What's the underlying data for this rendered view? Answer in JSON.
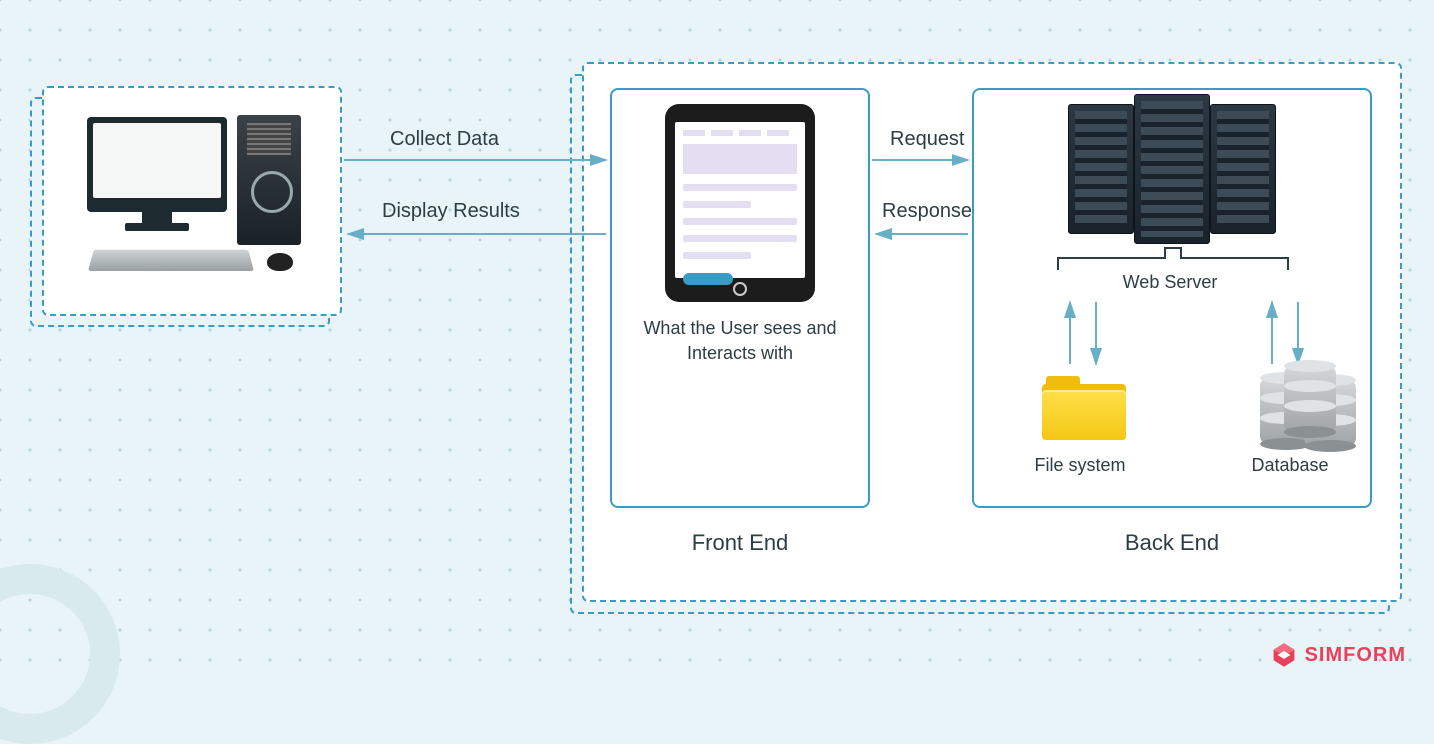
{
  "labels": {
    "collect": "Collect Data",
    "display": "Display Results",
    "request": "Request",
    "response": "Response",
    "frontend_caption": "What the User sees and Interacts with",
    "frontend_title": "Front End",
    "backend_title": "Back End",
    "webserver": "Web Server",
    "filesystem": "File system",
    "database": "Database"
  },
  "brand": {
    "name": "SIMFORM"
  },
  "colors": {
    "accent": "#3a9bc5",
    "brand": "#e8425b"
  }
}
